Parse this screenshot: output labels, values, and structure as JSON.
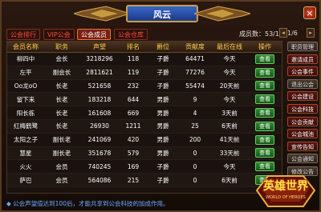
{
  "window": {
    "title": "风云",
    "close_label": "×"
  },
  "tabs": [
    {
      "label": "公会排行",
      "active": false
    },
    {
      "label": "VIP公会",
      "active": false
    },
    {
      "label": "公会成员",
      "active": true
    },
    {
      "label": "公会仓库",
      "active": false
    }
  ],
  "members_label": "成员数：53/100",
  "pagination": {
    "page_label": "1/6",
    "prev": "◂",
    "next": "▸"
  },
  "table": {
    "headers": [
      "会员名称",
      "职务",
      "声望",
      "排名",
      "爵位",
      "贡献度",
      "最后在线",
      "操作"
    ],
    "rows": [
      [
        "柳四中",
        "会长",
        "3218296",
        "118",
        "子爵",
        "64471",
        "今天",
        "查看"
      ],
      [
        "左平",
        "副会长",
        "2811621",
        "119",
        "子爵",
        "77276",
        "今天",
        "查看"
      ],
      [
        "Oo龙oO",
        "长老",
        "521658",
        "232",
        "子爵",
        "55474",
        "20天前",
        "查看"
      ],
      [
        "留下来",
        "长老",
        "183218",
        "644",
        "男爵",
        "9",
        "今天",
        "查看"
      ],
      [
        "阳长栋",
        "长老",
        "161608",
        "669",
        "男爵",
        "4",
        "3天前",
        "查看"
      ],
      [
        "红梅鹤鹭",
        "长老",
        "26930",
        "1211",
        "男爵",
        "25",
        "6天前",
        "查看"
      ],
      [
        "太阳之子",
        "副长老",
        "241069",
        "420",
        "男爵",
        "200",
        "41天前",
        "查看"
      ],
      [
        "慧星",
        "副长老",
        "351678",
        "579",
        "男爵",
        "0",
        "33天前",
        "查看"
      ],
      [
        "火火",
        "会员",
        "740245",
        "169",
        "子爵",
        "0",
        "今天",
        "查看"
      ],
      [
        "萨巴",
        "会员",
        "564086",
        "215",
        "子爵",
        "0",
        "6天前",
        "查看"
      ]
    ]
  },
  "side_menu": [
    {
      "label": "职员管理",
      "style": "dim"
    },
    {
      "label": "邀请成员",
      "style": "red"
    },
    {
      "label": "公会事件",
      "style": "red"
    },
    {
      "label": "退出公会",
      "style": "dim"
    },
    {
      "label": "公会建设",
      "style": "red"
    },
    {
      "label": "公会科技",
      "style": "red"
    },
    {
      "label": "公会贡献",
      "style": "red"
    },
    {
      "label": "公会城池",
      "style": "red"
    },
    {
      "label": "宣传告知",
      "style": "red"
    },
    {
      "label": "公会通知",
      "style": "dim"
    },
    {
      "label": "修改公告",
      "style": "dim"
    }
  ],
  "notice": "公会声望值达到100后，才能共享到公会科技的加成作用。",
  "logo": {
    "text": "英雄世界",
    "sub": "WORLD OF HEROES"
  },
  "colors": {
    "gold": "#ffcf4a",
    "view_button": "#2e8a2e",
    "notice": "#6aa8ff"
  }
}
